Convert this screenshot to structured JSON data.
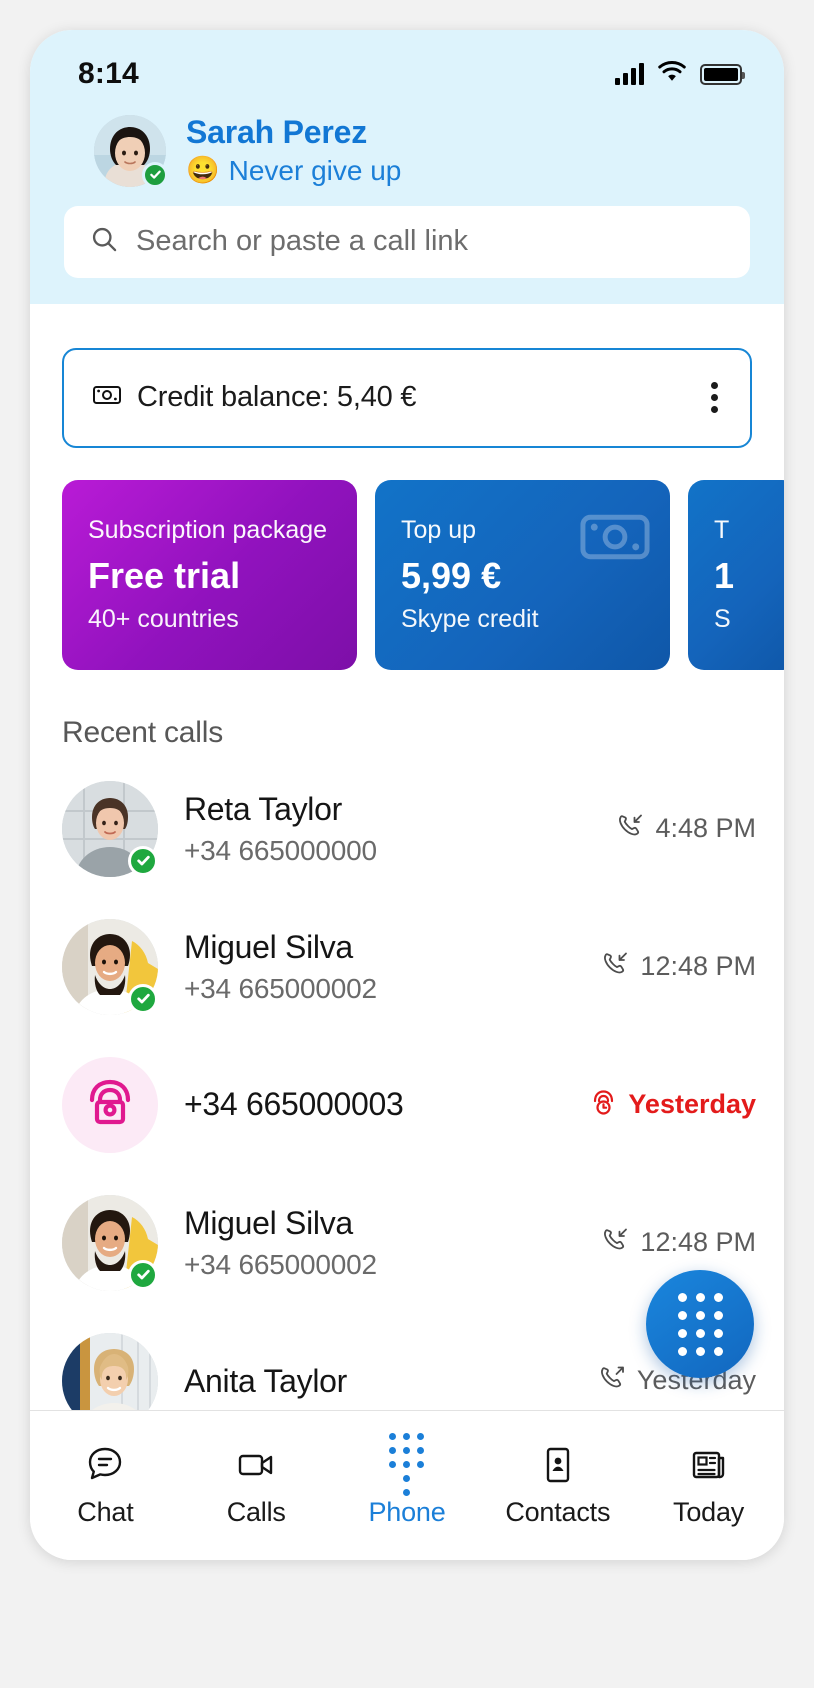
{
  "status_bar": {
    "time": "8:14",
    "signal_icon": "signal-bars-icon",
    "wifi_icon": "wifi-icon",
    "battery_icon": "battery-full-icon"
  },
  "header": {
    "profile_name": "Sarah Perez",
    "mood_emoji": "😀",
    "mood_text": "Never give up",
    "presence": "online",
    "search": {
      "placeholder": "Search or paste a call link",
      "icon": "search-icon"
    }
  },
  "credit": {
    "icon": "banknote-icon",
    "label": "Credit balance: 5,40 €",
    "menu_icon": "more-vertical-icon"
  },
  "promos": [
    {
      "top": "Subscription package",
      "mid": "Free trial",
      "bot": "40+ countries",
      "color": "#9012bd",
      "icon": ""
    },
    {
      "top": "Top up",
      "mid": "5,99 €",
      "bot": "Skype credit",
      "color": "#1464bb",
      "icon": "banknote-icon"
    },
    {
      "top": "T",
      "mid": "1",
      "bot": "S",
      "color": "#1464bb",
      "icon": ""
    }
  ],
  "recent": {
    "title": "Recent calls",
    "calls": [
      {
        "name": "Reta Taylor",
        "number": "+34 665000000",
        "time": "4:48 PM",
        "direction": "incoming",
        "presence": "online",
        "avatar_type": "photo"
      },
      {
        "name": "Miguel Silva",
        "number": "+34 665000002",
        "time": "12:48 PM",
        "direction": "incoming",
        "presence": "online",
        "avatar_type": "photo"
      },
      {
        "name": "",
        "number": "+34 665000003",
        "time": "Yesterday",
        "direction": "missed",
        "presence": "none",
        "avatar_type": "phone"
      },
      {
        "name": "Miguel Silva",
        "number": "+34 665000002",
        "time": "12:48 PM",
        "direction": "incoming",
        "presence": "online",
        "avatar_type": "photo"
      },
      {
        "name": "Anita Taylor",
        "number": "",
        "time": "Yesterday",
        "direction": "outgoing",
        "presence": "none",
        "avatar_type": "photo"
      }
    ]
  },
  "fab": {
    "icon": "dialpad-icon"
  },
  "bottom_nav": {
    "items": [
      {
        "label": "Chat",
        "icon": "chat-bubble-icon",
        "active": false
      },
      {
        "label": "Calls",
        "icon": "video-camera-icon",
        "active": false
      },
      {
        "label": "Phone",
        "icon": "dialpad-icon",
        "active": true
      },
      {
        "label": "Contacts",
        "icon": "contact-card-icon",
        "active": false
      },
      {
        "label": "Today",
        "icon": "news-icon",
        "active": false
      }
    ]
  },
  "colors": {
    "accent": "#1b7fd8",
    "header_bg": "#ddf3fc",
    "online": "#1fa83f",
    "missed": "#e31b1b",
    "promo_purple": "#9012bd",
    "promo_blue": "#1464bb"
  }
}
